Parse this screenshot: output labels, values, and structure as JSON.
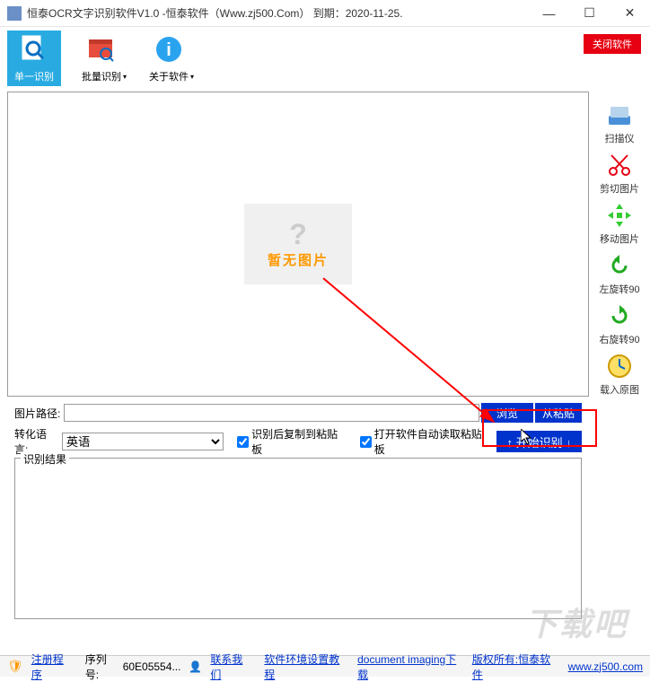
{
  "titlebar": {
    "title": "恒泰OCR文字识别软件V1.0 -恒泰软件（Www.zj500.Com）   到期：2020-11-25."
  },
  "toolbar": {
    "single": "单一识别",
    "batch": "批量识别",
    "about": "关于软件",
    "close_app": "关闭软件"
  },
  "side": {
    "scanner": "扫描仪",
    "crop": "剪切图片",
    "move": "移动图片",
    "rotate_left": "左旋转90",
    "rotate_right": "右旋转90",
    "load_orig": "载入原图"
  },
  "preview": {
    "no_image": "暂无图片"
  },
  "controls": {
    "path_label": "图片路径:",
    "browse": "浏览",
    "from_paste": "从粘贴",
    "lang_label": "转化语言:",
    "lang_value": "英语",
    "chk_copy": "识别后复制到粘贴板",
    "chk_auto": "打开软件自动读取粘贴板",
    "start": "↑ 开始识别 ↓"
  },
  "result": {
    "legend": "识别结果"
  },
  "status": {
    "reg": "注册程序",
    "serial_label": "序列号:",
    "serial": "60E05554...",
    "contact": "联系我们",
    "env": "软件环境设置教程",
    "docimg": "document imaging下载",
    "copyright": "版权所有:恒泰软件",
    "site": "www.zj500.com"
  },
  "watermark": "下载吧"
}
